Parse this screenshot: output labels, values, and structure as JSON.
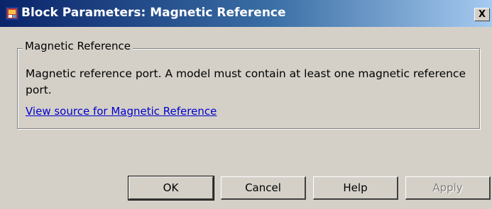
{
  "window": {
    "title": "Block Parameters: Magnetic Reference",
    "close_label": "X",
    "icon": "simulink-block-icon"
  },
  "group": {
    "legend": "Magnetic Reference",
    "description": "Magnetic reference port. A model must contain at least one magnetic reference port.",
    "link_text": "View source for Magnetic Reference"
  },
  "buttons": {
    "ok": "OK",
    "cancel": "Cancel",
    "help": "Help",
    "apply": "Apply"
  },
  "colors": {
    "title_gradient_start": "#0a246a",
    "title_gradient_end": "#a6caf0",
    "dialog_background": "#d4d0c8",
    "link": "#0000cc",
    "disabled_text": "#808080"
  }
}
